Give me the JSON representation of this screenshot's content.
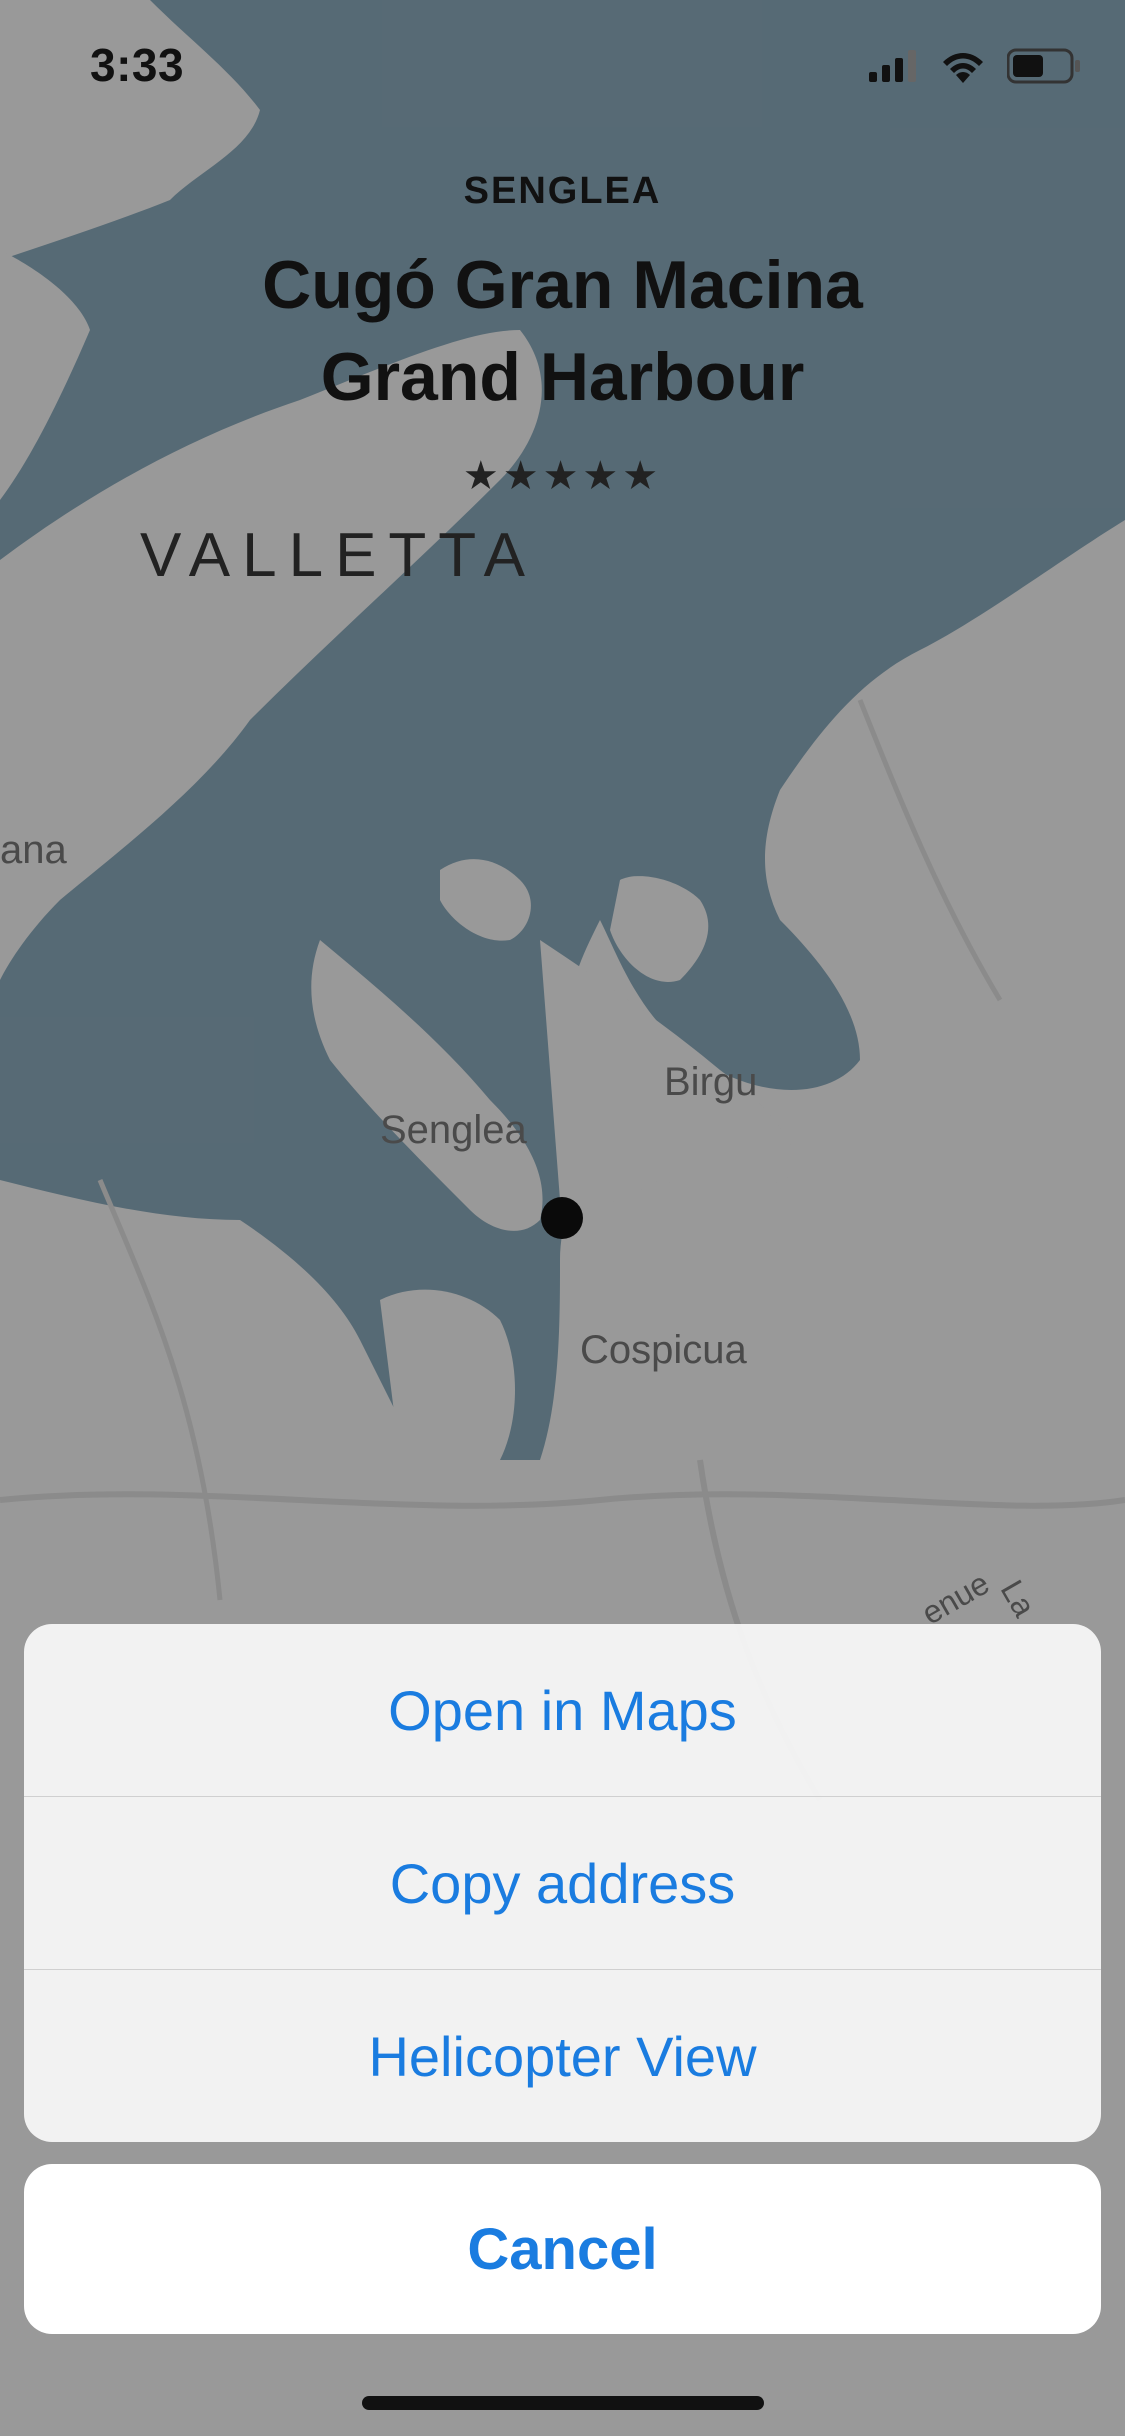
{
  "status_bar": {
    "time": "3:33"
  },
  "header": {
    "area": "SENGLEA",
    "name_line1": "Cugó Gran Macina",
    "name_line2": "Grand Harbour",
    "stars": "★★★★★",
    "rating": 5
  },
  "map": {
    "labels": {
      "valletta": "VALLETTA",
      "floriana_fragment": "ana",
      "senglea": "Senglea",
      "birgu": "Birgu",
      "cospicua": "Cospicua",
      "avenue_fragment": "enue",
      "la_fragment": "La"
    },
    "colors": {
      "water": "#6f8896",
      "land": "#c4c4c4"
    }
  },
  "action_sheet": {
    "items": [
      {
        "label": "Open in Maps"
      },
      {
        "label": "Copy address"
      },
      {
        "label": "Helicopter View"
      }
    ],
    "cancel_label": "Cancel",
    "accent_color": "#1a7ce0"
  },
  "icons": {
    "signal": "cellular-signal-icon",
    "wifi": "wifi-icon",
    "battery": "battery-icon",
    "pin": "location-pin-icon"
  }
}
